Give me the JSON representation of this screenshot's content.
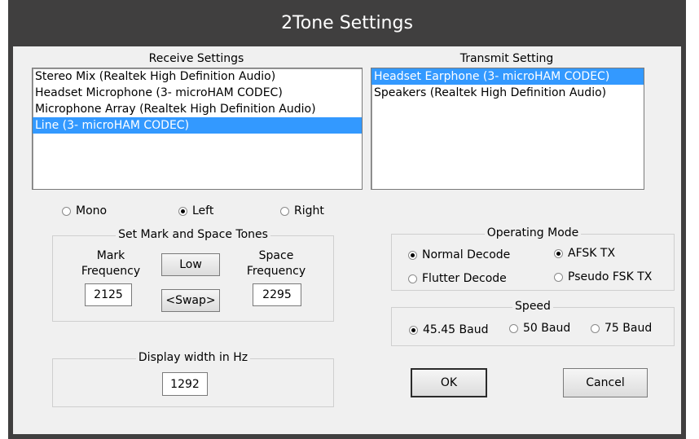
{
  "window": {
    "title": "2Tone Settings"
  },
  "receive": {
    "label": "Receive Settings",
    "items": [
      "Stereo Mix (Realtek High Definition Audio)",
      "Headset Microphone (3- microHAM CODEC)",
      "Microphone Array (Realtek High Definition Audio)",
      "Line (3- microHAM CODEC)"
    ],
    "selected_index": 3
  },
  "transmit": {
    "label": "Transmit Setting",
    "items": [
      "Headset Earphone (3- microHAM CODEC)",
      "Speakers (Realtek High Definition Audio)"
    ],
    "selected_index": 0
  },
  "channel": {
    "mono": "Mono",
    "left": "Left",
    "right": "Right",
    "selected": "left"
  },
  "tones": {
    "title": "Set Mark and Space Tones",
    "mark_label_1": "Mark",
    "mark_label_2": "Frequency",
    "mark_value": "2125",
    "space_label_1": "Space",
    "space_label_2": "Frequency",
    "space_value": "2295",
    "low_button": "Low",
    "swap_button": "<Swap>"
  },
  "display": {
    "title": "Display width in Hz",
    "value": "1292"
  },
  "operating_mode": {
    "title": "Operating Mode",
    "normal": "Normal Decode",
    "flutter": "Flutter Decode",
    "afsk": "AFSK TX",
    "pseudo": "Pseudo FSK TX",
    "decode_selected": "normal",
    "tx_selected": "afsk"
  },
  "speed": {
    "title": "Speed",
    "baud_45": "45.45 Baud",
    "baud_50": "50 Baud",
    "baud_75": "75 Baud",
    "selected": "45.45"
  },
  "buttons": {
    "ok": "OK",
    "cancel": "Cancel"
  }
}
